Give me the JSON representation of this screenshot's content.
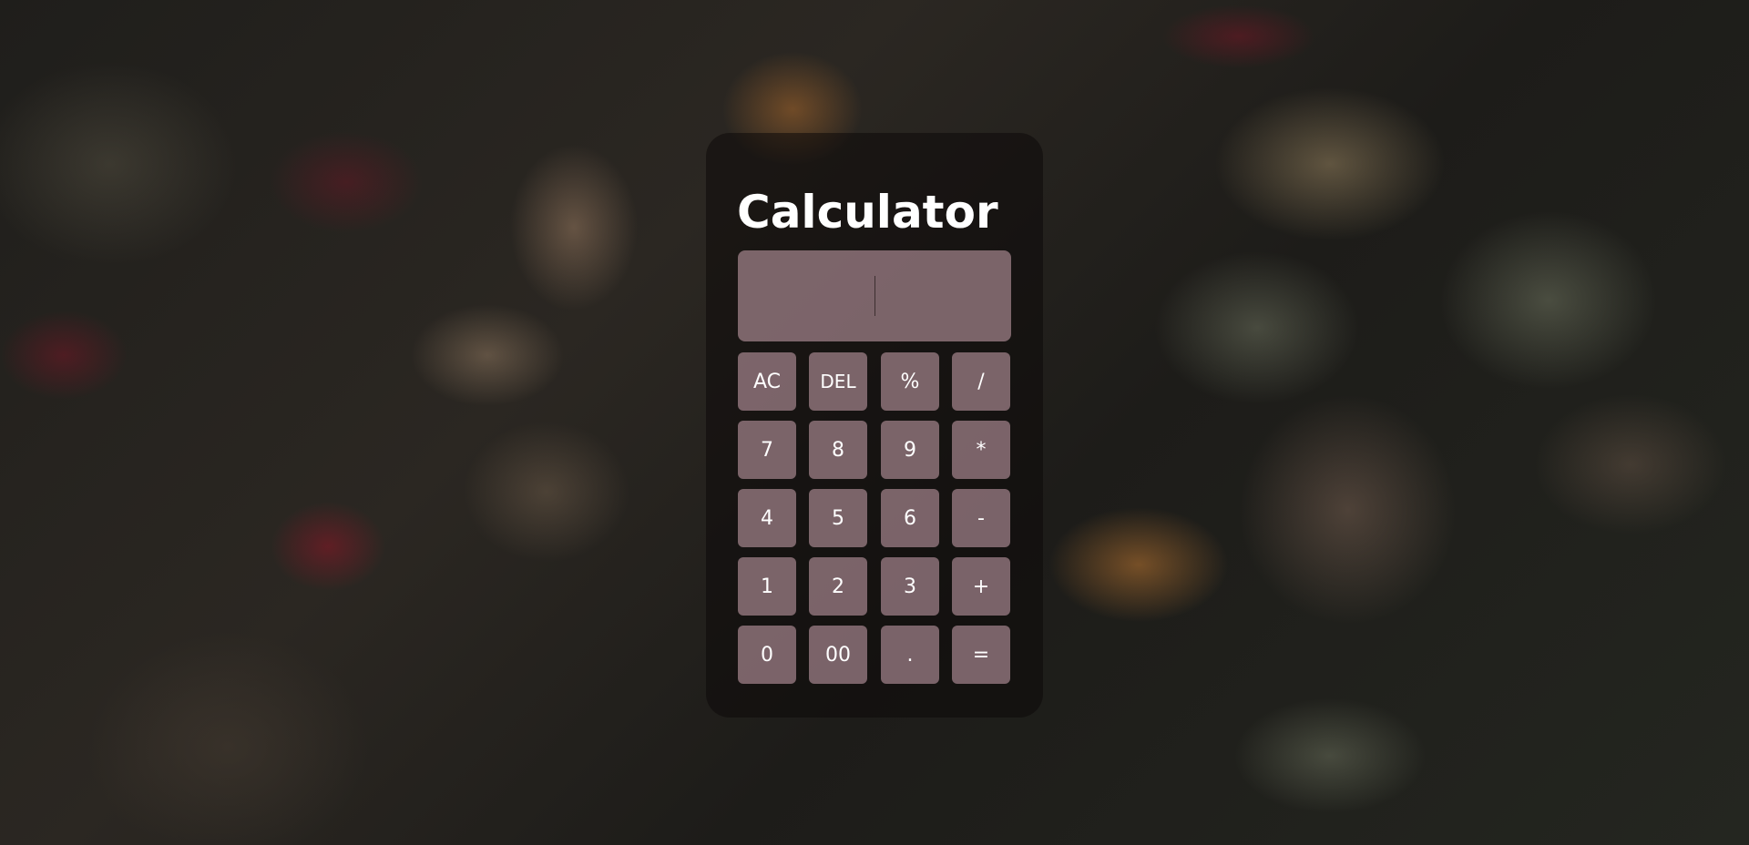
{
  "app": {
    "title": "Calculator"
  },
  "display": {
    "value": ""
  },
  "keypad": {
    "rows": [
      [
        "AC",
        "DEL",
        "%",
        "/"
      ],
      [
        "7",
        "8",
        "9",
        "*"
      ],
      [
        "4",
        "5",
        "6",
        "-"
      ],
      [
        "1",
        "2",
        "3",
        "+"
      ],
      [
        "0",
        "00",
        ".",
        "="
      ]
    ]
  },
  "colors": {
    "card": "#0c0a0a",
    "button": "#b996a0",
    "text": "#ffffff"
  }
}
